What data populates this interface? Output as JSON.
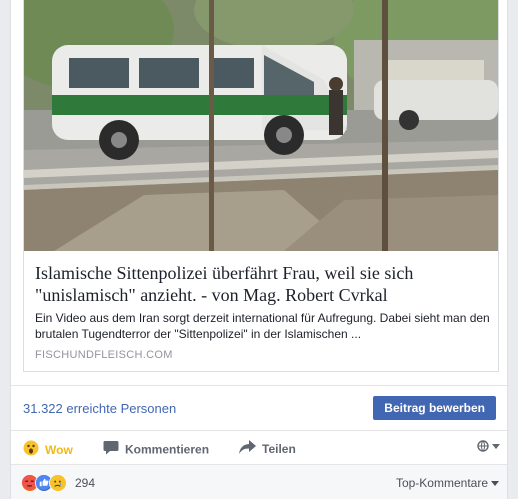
{
  "link_preview": {
    "title": "Islamische Sittenpolizei überfährt Frau, weil sie sich \"unislamisch\" anzieht. - von Mag. Robert Cvrkal",
    "description": "Ein Video aus dem Iran sorgt derzeit international für Aufregung. Dabei sieht man den brutalen Tugendterror der \"Sittenpolizei\" in der Islamischen ...",
    "domain": "FISCHUNDFLEISCH.COM"
  },
  "reach": {
    "text": "31.322 erreichte Personen",
    "boost_label": "Beitrag bewerben"
  },
  "actions": {
    "wow_label": "Wow",
    "comment_label": "Kommentieren",
    "share_label": "Teilen",
    "audience_icon": "globe-icon"
  },
  "reactions": {
    "icons": [
      "angry-icon",
      "like-icon",
      "sad-icon"
    ],
    "count": "294",
    "sort_label": "Top-Kommentare"
  },
  "colors": {
    "link_blue": "#4267b2",
    "wow_yellow": "#f0ba15",
    "text_grey": "#606770"
  }
}
